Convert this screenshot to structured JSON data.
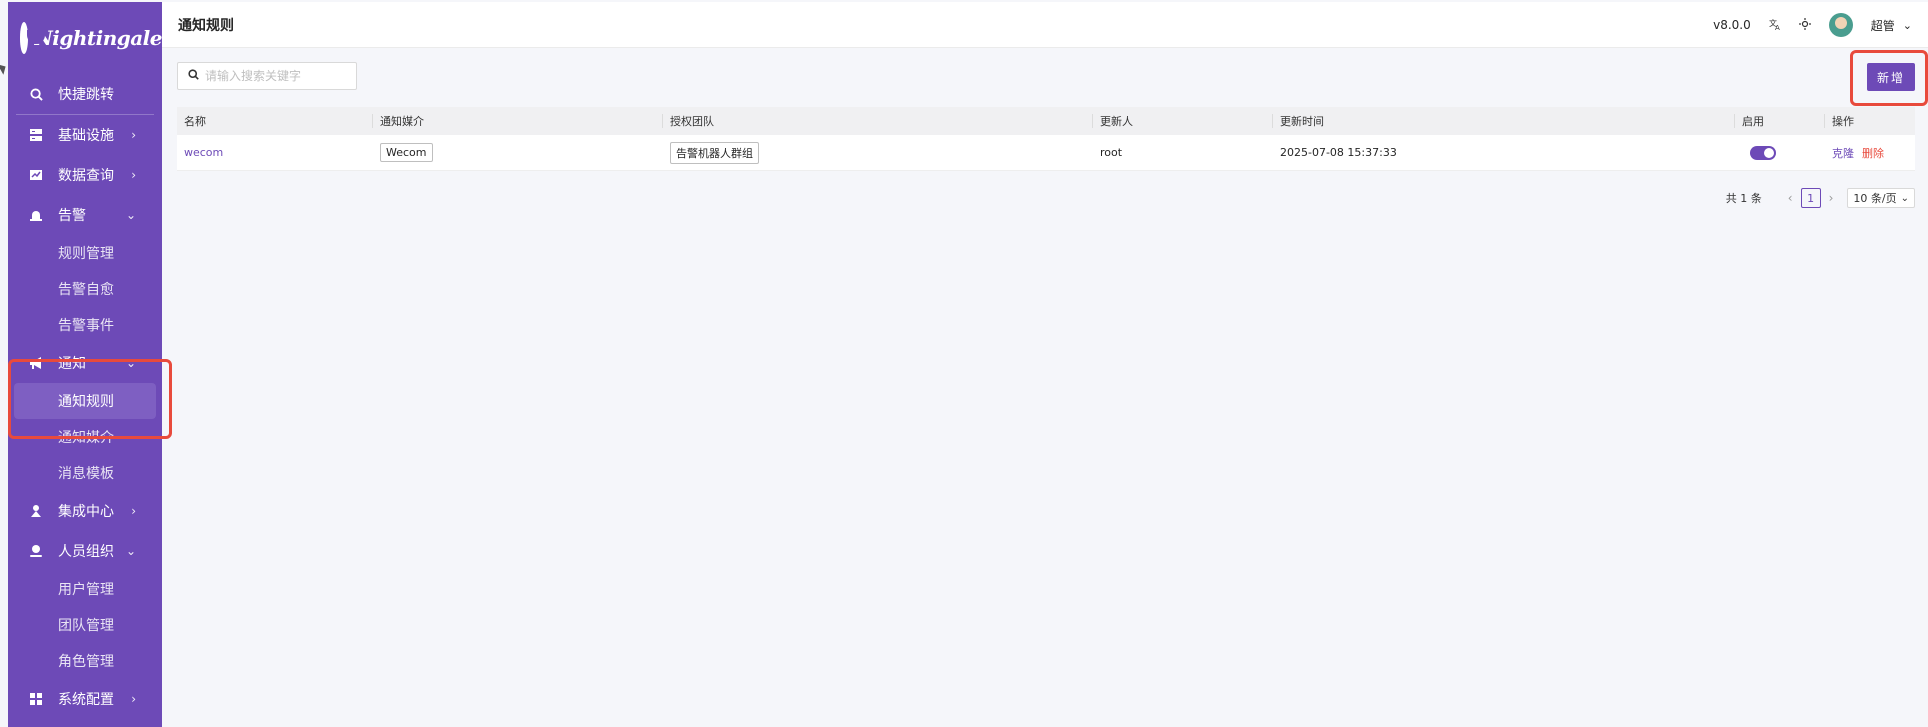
{
  "app": {
    "logo_text": "Nightingale",
    "version": "v8.0.0",
    "user": "超管"
  },
  "sidebar": {
    "quick_jump": "快捷跳转",
    "items": [
      {
        "label": "基础设施",
        "icon": "server-icon"
      },
      {
        "label": "数据查询",
        "icon": "chart-icon"
      },
      {
        "label": "告警",
        "icon": "alarm-icon",
        "children": [
          "规则管理",
          "告警自愈",
          "告警事件"
        ]
      },
      {
        "label": "通知",
        "icon": "megaphone-icon",
        "children": [
          "通知规则",
          "通知媒介",
          "消息模板"
        ]
      },
      {
        "label": "集成中心",
        "icon": "integration-icon"
      },
      {
        "label": "人员组织",
        "icon": "user-icon",
        "children": [
          "用户管理",
          "团队管理",
          "角色管理"
        ]
      },
      {
        "label": "系统配置",
        "icon": "grid-icon"
      }
    ]
  },
  "header": {
    "title": "通知规则"
  },
  "toolbar": {
    "search_placeholder": "请输入搜索关键字",
    "add_label": "新增"
  },
  "table": {
    "columns": [
      "名称",
      "通知媒介",
      "授权团队",
      "更新人",
      "更新时间",
      "启用",
      "操作"
    ],
    "rows": [
      {
        "name": "wecom",
        "media": "Wecom",
        "team": "告警机器人群组",
        "updater": "root",
        "updated_at": "2025-07-08 15:37:33",
        "enabled": true,
        "op_clone": "克隆",
        "op_delete": "删除"
      }
    ]
  },
  "pagination": {
    "total": "共 1 条",
    "current": "1",
    "page_size": "10 条/页"
  },
  "colors": {
    "brand": "#6d4ab7",
    "danger": "#e84a3c",
    "highlight": "#e84a3c"
  }
}
